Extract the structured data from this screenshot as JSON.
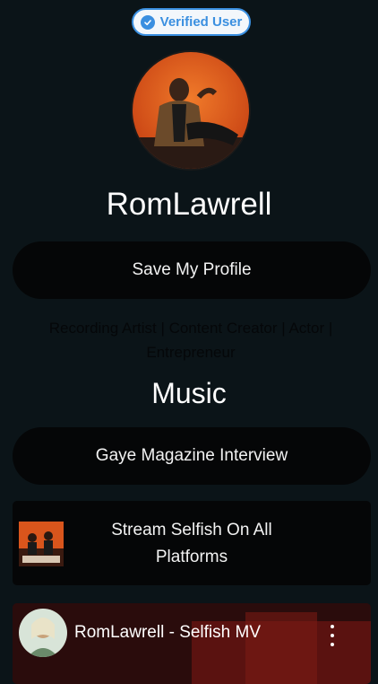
{
  "badge": {
    "label": "Verified User",
    "color": "#3a8fe0"
  },
  "profile": {
    "avatar_icon": "profile-photo",
    "name": "RomLawrell"
  },
  "buttons": {
    "save_profile": "Save My Profile",
    "interview": "Gaye Magazine Interview"
  },
  "bio": {
    "line1": "Recording Artist | Content Creator | Actor |",
    "line2": "Entrepreneur"
  },
  "music": {
    "section_title": "Music",
    "stream_card": {
      "line1": "Stream Selfish On All",
      "line2": "Platforms",
      "thumbnail_icon": "album-art"
    },
    "video_card": {
      "title": "RomLawrell - Selfish MV",
      "menu_icon": "more-vertical-icon"
    }
  },
  "colors": {
    "background": "#0b1418",
    "card": "#050607",
    "accent_orange": "#e85a1c"
  }
}
